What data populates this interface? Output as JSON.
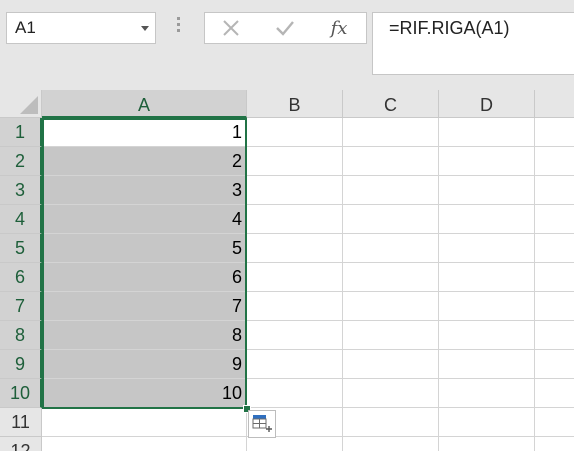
{
  "namebox": {
    "value": "A1"
  },
  "formula_bar": {
    "fx_label": "fx",
    "formula": "=RIF.RIGA(A1)"
  },
  "columns": [
    "A",
    "B",
    "C",
    "D"
  ],
  "rows": [
    "1",
    "2",
    "3",
    "4",
    "5",
    "6",
    "7",
    "8",
    "9",
    "10",
    "11",
    "12"
  ],
  "cells_A": [
    "1",
    "2",
    "3",
    "4",
    "5",
    "6",
    "7",
    "8",
    "9",
    "10"
  ],
  "colors": {
    "accent": "#217346",
    "selection_fill": "#c6c6c6"
  }
}
